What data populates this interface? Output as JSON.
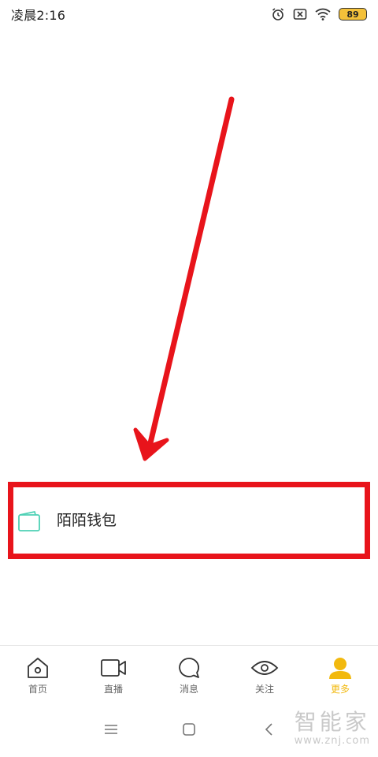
{
  "status_bar": {
    "time": "凌晨2:16",
    "battery": "89",
    "icons": [
      "alarm-icon",
      "sim-off-icon",
      "wifi-icon",
      "battery-icon"
    ]
  },
  "main": {
    "wallet_label": "陌陌钱包",
    "wallet_icon": "wallet-icon",
    "highlight_color": "#e8141b"
  },
  "tabs": [
    {
      "label": "首页",
      "icon": "home-icon"
    },
    {
      "label": "直播",
      "icon": "video-camera-icon"
    },
    {
      "label": "消息",
      "icon": "message-bubble-icon"
    },
    {
      "label": "关注",
      "icon": "eye-icon"
    },
    {
      "label": "更多",
      "icon": "user-icon",
      "active": true,
      "color": "#f2b90f"
    }
  ],
  "nav_bar": {
    "icons": [
      "menu-icon",
      "home-square-icon",
      "back-icon"
    ]
  },
  "watermark": {
    "main": "智能家",
    "sub": "www.znj.com"
  }
}
